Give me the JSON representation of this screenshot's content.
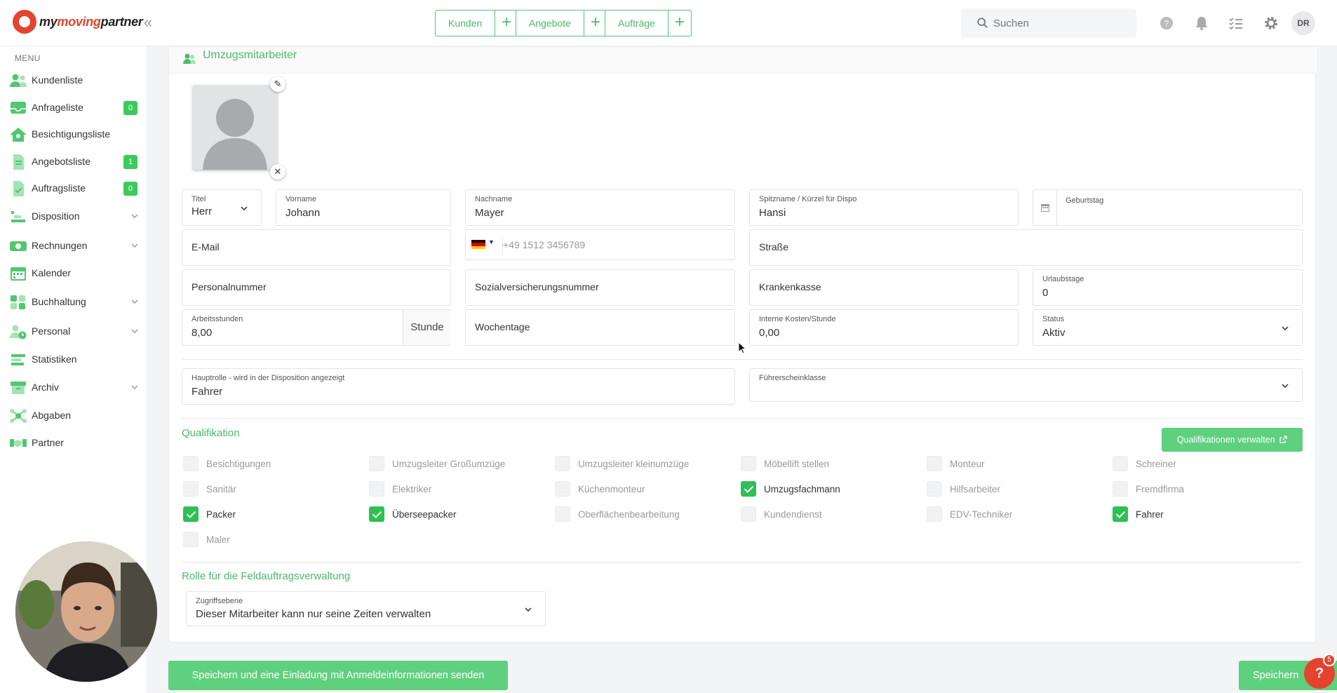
{
  "brand": {
    "name_part1": "my",
    "name_part2": "moving",
    "name_part3": "partner"
  },
  "topbar": {
    "quick_actions": [
      {
        "label": "Kunden"
      },
      {
        "label": "Angebote"
      },
      {
        "label": "Aufträge"
      }
    ],
    "search": {
      "placeholder": "Suchen"
    },
    "avatar_initials": "DR"
  },
  "sidebar": {
    "menu_title": "MENU",
    "items": [
      {
        "label": "Kundenliste"
      },
      {
        "label": "Anfrageliste",
        "badge": "0"
      },
      {
        "label": "Besichtigungsliste"
      },
      {
        "label": "Angebotsliste",
        "badge": "1"
      },
      {
        "label": "Auftragsliste",
        "badge": "0"
      },
      {
        "label": "Disposition"
      },
      {
        "label": "Rechnungen"
      },
      {
        "label": "Kalender"
      },
      {
        "label": "Buchhaltung"
      },
      {
        "label": "Personal"
      },
      {
        "label": "Statistiken"
      },
      {
        "label": "Archiv"
      },
      {
        "label": "Abgaben"
      },
      {
        "label": "Partner"
      }
    ]
  },
  "form": {
    "title": "Umzugsmitarbeiter",
    "titel": {
      "label": "Titel",
      "value": "Herr"
    },
    "vorname": {
      "label": "Vorname",
      "value": "Johann"
    },
    "nachname": {
      "label": "Nachname",
      "value": "Mayer"
    },
    "spitzname": {
      "label": "Spitzname / Kürzel für Dispo",
      "value": "Hansi"
    },
    "geburtstag": {
      "label": "Geburtstag",
      "value": ""
    },
    "email": {
      "placeholder": "E-Mail"
    },
    "telefon": {
      "placeholder": "+49 1512 3456789"
    },
    "strasse": {
      "placeholder": "Straße"
    },
    "personalnummer": {
      "placeholder": "Personalnummer"
    },
    "sozialversicherungsnummer": {
      "placeholder": "Sozialversicherungsnummer"
    },
    "krankenkasse": {
      "placeholder": "Krankenkasse"
    },
    "urlaubstage": {
      "label": "Urlaubstage",
      "value": "0"
    },
    "arbeitsstunden": {
      "label": "Arbeitsstunden",
      "value": "8,00",
      "unit": "Stunde"
    },
    "wochentage": {
      "placeholder": "Wochentage"
    },
    "interne_kosten": {
      "label": "Interne Kosten/Stunde",
      "value": "0,00"
    },
    "status": {
      "label": "Status",
      "value": "Aktiv"
    },
    "hauptrolle": {
      "label": "Hauptrolle - wird in der Disposition angezeigt",
      "value": "Fahrer"
    },
    "fuehrerscheinklasse": {
      "label": "Führerscheinklasse",
      "value": ""
    }
  },
  "qualifikation": {
    "title": "Qualifikation",
    "manage_button": "Qualifikationen verwalten",
    "items": [
      {
        "label": "Besichtigungen",
        "checked": false
      },
      {
        "label": "Umzugsleiter Großumzüge",
        "checked": false
      },
      {
        "label": "Umzugsleiter kleinumzüge",
        "checked": false
      },
      {
        "label": "Möbellift stellen",
        "checked": false
      },
      {
        "label": "Monteur",
        "checked": false
      },
      {
        "label": "Schreiner",
        "checked": false
      },
      {
        "label": "Sanitär",
        "checked": false
      },
      {
        "label": "Elektriker",
        "checked": false
      },
      {
        "label": "Küchenmonteur",
        "checked": false
      },
      {
        "label": "Umzugsfachmann",
        "checked": true
      },
      {
        "label": "Hilfsarbeiter",
        "checked": false
      },
      {
        "label": "Fremdfirma",
        "checked": false
      },
      {
        "label": "Packer",
        "checked": true
      },
      {
        "label": "Überseepacker",
        "checked": true
      },
      {
        "label": "Oberflächenbearbeitung",
        "checked": false
      },
      {
        "label": "Kundendienst",
        "checked": false
      },
      {
        "label": "EDV-Techniker",
        "checked": false
      },
      {
        "label": "Fahrer",
        "checked": true
      },
      {
        "label": "Maler",
        "checked": false
      }
    ]
  },
  "rolle": {
    "title": "Rolle für die Feldauftragsverwaltung",
    "zugriffsebene": {
      "label": "Zugriffsebene",
      "value": "Dieser Mitarbeiter kann nur seine Zeiten verwalten"
    }
  },
  "actions": {
    "save_invite": "Speichern und eine Einladung mit Anmeldeinformationen senden",
    "save": "Speichern"
  },
  "help": {
    "label": "?",
    "badge": "5"
  },
  "colors": {
    "accent": "#4cb96a",
    "button": "#5fd07d",
    "checked": "#2ec052",
    "brand_red": "#e4432e"
  }
}
